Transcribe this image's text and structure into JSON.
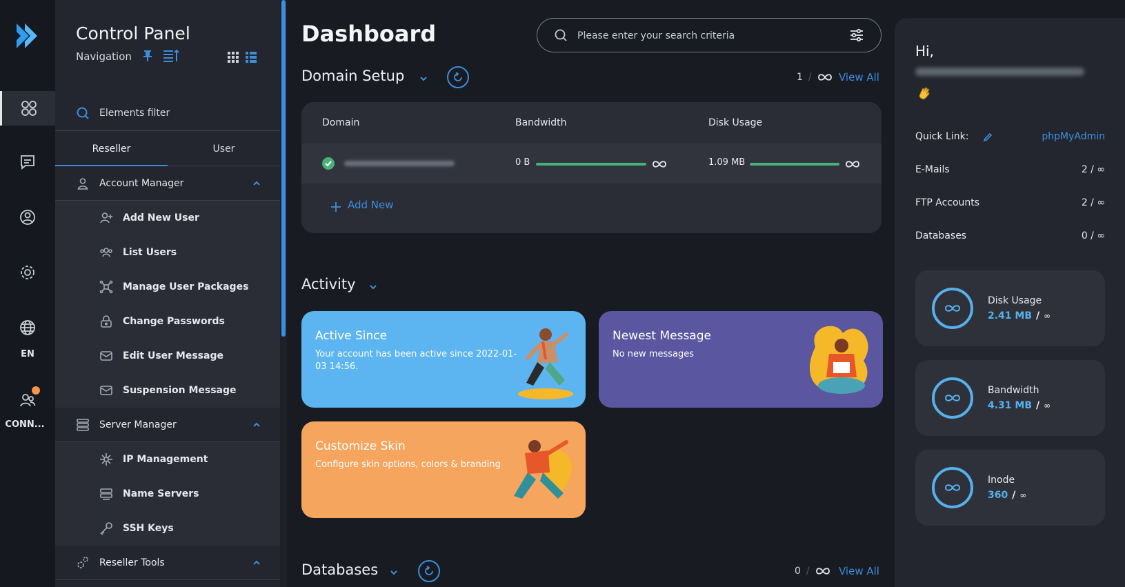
{
  "rail": {
    "language": "EN",
    "user_label": "CONN..."
  },
  "nav": {
    "title": "Control Panel",
    "subtitle": "Navigation",
    "filter_label": "Elements filter",
    "tabs": [
      "Reseller",
      "User"
    ],
    "account_manager": {
      "label": "Account Manager",
      "items": [
        "Add New User",
        "List Users",
        "Manage User Packages",
        "Change Passwords",
        "Edit User Message",
        "Suspension Message"
      ]
    },
    "server_manager": {
      "label": "Server Manager",
      "items": [
        "IP Management",
        "Name Servers",
        "SSH Keys"
      ]
    },
    "reseller_tools": {
      "label": "Reseller Tools"
    }
  },
  "main": {
    "title": "Dashboard",
    "search_placeholder": "Please enter your search criteria",
    "domain_setup": {
      "title": "Domain Setup",
      "count": "1",
      "view_all": "View All",
      "headers": [
        "Domain",
        "Bandwidth",
        "Disk Usage"
      ],
      "row": {
        "bandwidth": "0 B",
        "disk_usage": "1.09 MB"
      },
      "add_new": "Add New"
    },
    "activity": {
      "title": "Activity",
      "cards": [
        {
          "title": "Active Since",
          "desc": "Your account has been active since 2022-01-03 14:56.",
          "color": "#5cb5f0"
        },
        {
          "title": "Newest Message",
          "desc": "No new messages",
          "color": "#5a56a0"
        },
        {
          "title": "Customize Skin",
          "desc": "Configure skin options, colors & branding",
          "color": "#f5a55e"
        }
      ]
    },
    "databases": {
      "title": "Databases",
      "count": "0",
      "view_all": "View All"
    }
  },
  "right": {
    "greeting": "Hi,",
    "quick_link_label": "Quick Link:",
    "quick_link_value": "phpMyAdmin",
    "rows": [
      {
        "label": "E-Mails",
        "value": "2 / ∞"
      },
      {
        "label": "FTP Accounts",
        "value": "2 / ∞"
      },
      {
        "label": "Databases",
        "value": "0 / ∞"
      }
    ],
    "stats": [
      {
        "name": "Disk Usage",
        "value": "2.41 MB",
        "limit": "∞"
      },
      {
        "name": "Bandwidth",
        "value": "4.31 MB",
        "limit": "∞"
      },
      {
        "name": "Inode",
        "value": "360",
        "limit": "∞"
      }
    ]
  },
  "colors": {
    "accent": "#3e8ede",
    "success": "#48b07a",
    "ring": "#57b0ec",
    "notification": "#f3954a"
  }
}
